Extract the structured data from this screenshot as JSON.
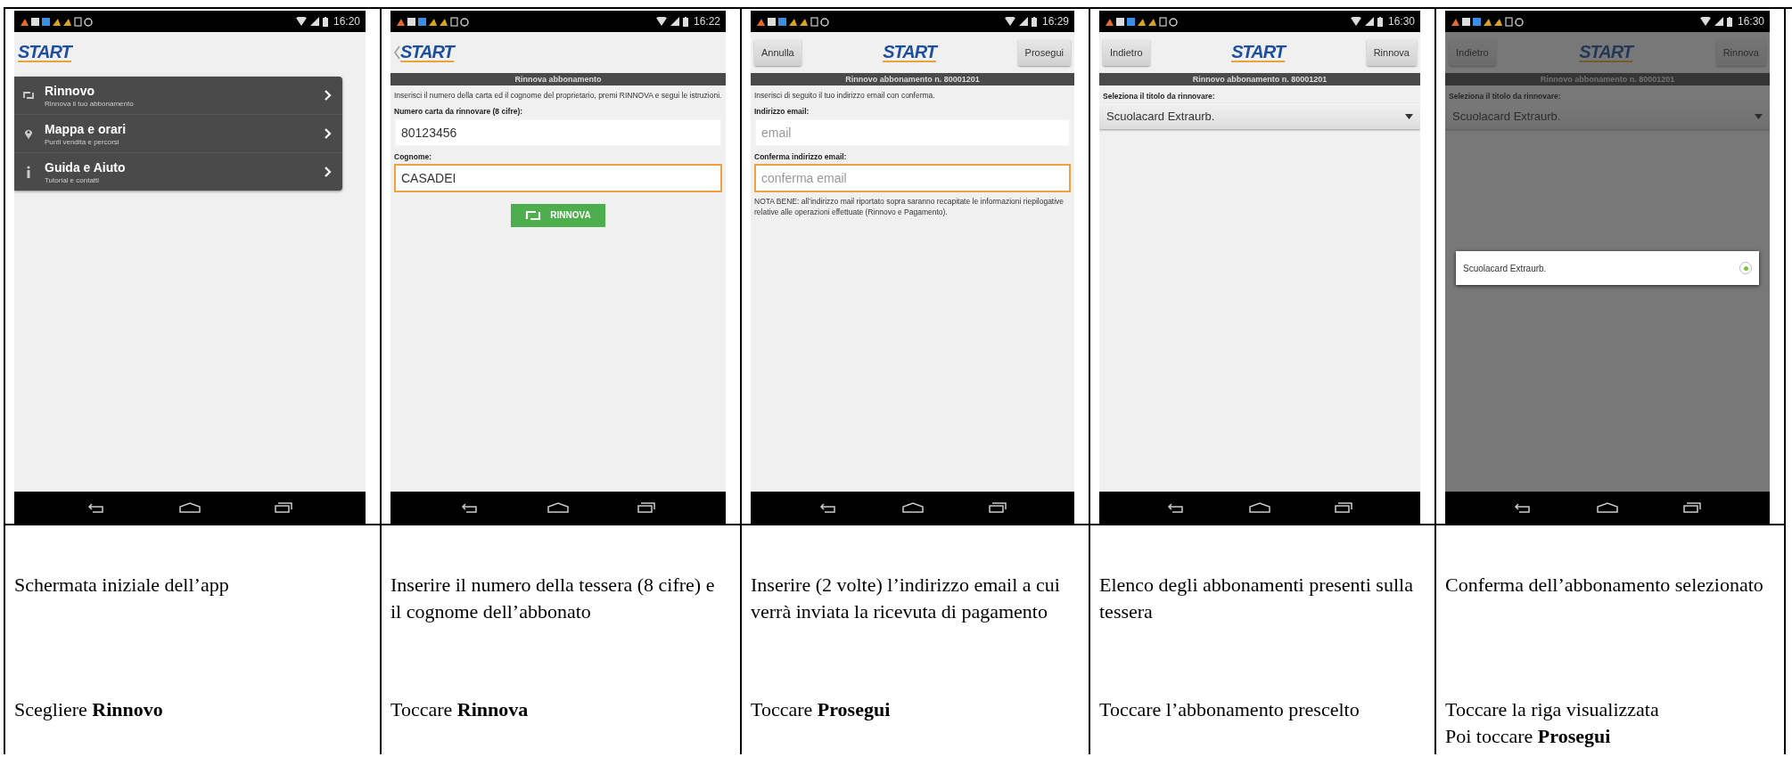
{
  "steps": [
    {
      "phone": {
        "time": "16:20",
        "dimmed": false,
        "header": {
          "back": false,
          "logo": "START"
        },
        "content": [
          {
            "kind": "menu_item",
            "title": "Rinnovo",
            "subtitle": "Rinnova il tuo abbonamento"
          },
          {
            "kind": "menu_item",
            "title": "Mappa e orari",
            "subtitle": "Punti vendita e percorsi"
          },
          {
            "kind": "menu_item",
            "title": "Guida e Aiuto",
            "subtitle": "Tutorial e contatti"
          }
        ]
      },
      "description": "Schermata iniziale dell’app",
      "actions": [
        "Scegliere **Rinnovo**"
      ]
    },
    {
      "phone": {
        "time": "16:22",
        "dimmed": false,
        "header": {
          "back": true,
          "logo": "START"
        },
        "title_bar": "Rinnova abbonamento",
        "content": [
          {
            "kind": "text",
            "text": "Inserisci il numero della carta ed il cognome del proprietario, premi RINNOVA e segui le istruzioni."
          },
          {
            "kind": "label",
            "text": "Numero carta da rinnovare (8 cifre):"
          },
          {
            "kind": "input",
            "value": "80123456",
            "focused": false
          },
          {
            "kind": "label",
            "text": "Cognome:"
          },
          {
            "kind": "input",
            "value": "CASADEI",
            "focused": true
          },
          {
            "kind": "button",
            "label": "RINNOVA"
          }
        ]
      },
      "description": "Inserire il numero della tessera (8 cifre) e il cognome dell’abbonato",
      "actions": [
        "Toccare **Rinnova**"
      ]
    },
    {
      "phone": {
        "time": "16:29",
        "dimmed": false,
        "header": {
          "back": false,
          "logo": "START",
          "left_button": "Annulla",
          "right_button": "Prosegui"
        },
        "title_bar": "Rinnovo abbonamento n. 80001201",
        "content": [
          {
            "kind": "text",
            "text": "Inserisci di seguito il tuo indirizzo email con conferma."
          },
          {
            "kind": "label",
            "text": "Indirizzo email:"
          },
          {
            "kind": "input",
            "placeholder": "email",
            "focused": false
          },
          {
            "kind": "label",
            "text": "Conferma indirizzo email:"
          },
          {
            "kind": "input",
            "placeholder": "conferma email",
            "focused": true
          },
          {
            "kind": "text",
            "text": "NOTA BENE: all’indirizzo mail riportato sopra saranno recapitate le informazioni riepilogative relative alle operazioni effettuate (Rinnovo e Pagamento)."
          }
        ]
      },
      "description": "Inserire (2 volte) l’indirizzo email a cui verrà inviata la ricevuta di pagamento",
      "actions": [
        "Toccare **Prosegui**"
      ]
    },
    {
      "phone": {
        "time": "16:30",
        "dimmed": false,
        "header": {
          "back": false,
          "logo": "START",
          "left_button": "Indietro",
          "right_button": "Rinnova"
        },
        "title_bar": "Rinnovo abbonamento n. 80001201",
        "content": [
          {
            "kind": "label",
            "text": "Seleziona il titolo da rinnovare:"
          },
          {
            "kind": "select",
            "value": "Scuolacard Extraurb."
          }
        ]
      },
      "description": "Elenco degli abbonamenti presenti sulla tessera",
      "actions": [
        "Toccare l’abbonamento prescelto"
      ]
    },
    {
      "phone": {
        "time": "16:30",
        "dimmed": true,
        "header": {
          "back": false,
          "logo": "START",
          "left_button": "Indietro",
          "right_button": "Rinnova"
        },
        "title_bar": "Rinnovo abbonamento n. 80001201",
        "content": [
          {
            "kind": "label",
            "text": "Seleziona il titolo da rinnovare:"
          },
          {
            "kind": "select",
            "value": "Scuolacard Extraurb."
          }
        ],
        "dialog": {
          "options": [
            {
              "label": "Scuolacard Extraurb.",
              "selected": true
            }
          ]
        }
      },
      "description": "Conferma dell’abbonamento selezionato",
      "actions": [
        "Toccare la riga visualizzata",
        "Poi toccare **Prosegui**"
      ]
    }
  ]
}
